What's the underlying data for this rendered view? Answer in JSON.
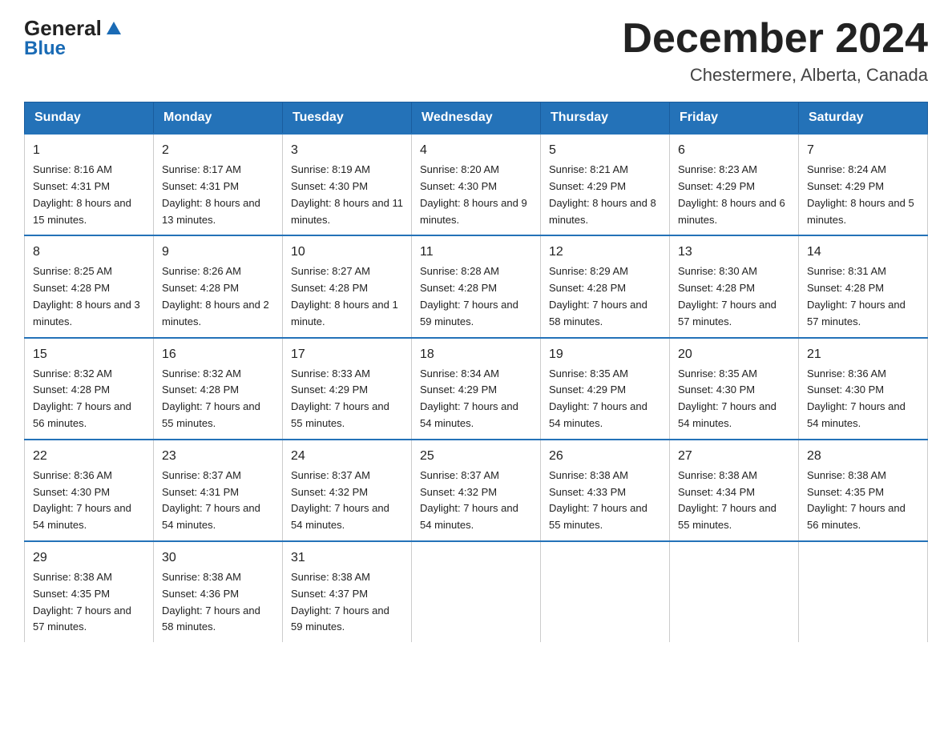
{
  "header": {
    "logo_general": "General",
    "logo_blue": "Blue",
    "month_title": "December 2024",
    "location": "Chestermere, Alberta, Canada"
  },
  "days_of_week": [
    "Sunday",
    "Monday",
    "Tuesday",
    "Wednesday",
    "Thursday",
    "Friday",
    "Saturday"
  ],
  "weeks": [
    [
      {
        "day": "1",
        "sunrise": "8:16 AM",
        "sunset": "4:31 PM",
        "daylight": "8 hours and 15 minutes."
      },
      {
        "day": "2",
        "sunrise": "8:17 AM",
        "sunset": "4:31 PM",
        "daylight": "8 hours and 13 minutes."
      },
      {
        "day": "3",
        "sunrise": "8:19 AM",
        "sunset": "4:30 PM",
        "daylight": "8 hours and 11 minutes."
      },
      {
        "day": "4",
        "sunrise": "8:20 AM",
        "sunset": "4:30 PM",
        "daylight": "8 hours and 9 minutes."
      },
      {
        "day": "5",
        "sunrise": "8:21 AM",
        "sunset": "4:29 PM",
        "daylight": "8 hours and 8 minutes."
      },
      {
        "day": "6",
        "sunrise": "8:23 AM",
        "sunset": "4:29 PM",
        "daylight": "8 hours and 6 minutes."
      },
      {
        "day": "7",
        "sunrise": "8:24 AM",
        "sunset": "4:29 PM",
        "daylight": "8 hours and 5 minutes."
      }
    ],
    [
      {
        "day": "8",
        "sunrise": "8:25 AM",
        "sunset": "4:28 PM",
        "daylight": "8 hours and 3 minutes."
      },
      {
        "day": "9",
        "sunrise": "8:26 AM",
        "sunset": "4:28 PM",
        "daylight": "8 hours and 2 minutes."
      },
      {
        "day": "10",
        "sunrise": "8:27 AM",
        "sunset": "4:28 PM",
        "daylight": "8 hours and 1 minute."
      },
      {
        "day": "11",
        "sunrise": "8:28 AM",
        "sunset": "4:28 PM",
        "daylight": "7 hours and 59 minutes."
      },
      {
        "day": "12",
        "sunrise": "8:29 AM",
        "sunset": "4:28 PM",
        "daylight": "7 hours and 58 minutes."
      },
      {
        "day": "13",
        "sunrise": "8:30 AM",
        "sunset": "4:28 PM",
        "daylight": "7 hours and 57 minutes."
      },
      {
        "day": "14",
        "sunrise": "8:31 AM",
        "sunset": "4:28 PM",
        "daylight": "7 hours and 57 minutes."
      }
    ],
    [
      {
        "day": "15",
        "sunrise": "8:32 AM",
        "sunset": "4:28 PM",
        "daylight": "7 hours and 56 minutes."
      },
      {
        "day": "16",
        "sunrise": "8:32 AM",
        "sunset": "4:28 PM",
        "daylight": "7 hours and 55 minutes."
      },
      {
        "day": "17",
        "sunrise": "8:33 AM",
        "sunset": "4:29 PM",
        "daylight": "7 hours and 55 minutes."
      },
      {
        "day": "18",
        "sunrise": "8:34 AM",
        "sunset": "4:29 PM",
        "daylight": "7 hours and 54 minutes."
      },
      {
        "day": "19",
        "sunrise": "8:35 AM",
        "sunset": "4:29 PM",
        "daylight": "7 hours and 54 minutes."
      },
      {
        "day": "20",
        "sunrise": "8:35 AM",
        "sunset": "4:30 PM",
        "daylight": "7 hours and 54 minutes."
      },
      {
        "day": "21",
        "sunrise": "8:36 AM",
        "sunset": "4:30 PM",
        "daylight": "7 hours and 54 minutes."
      }
    ],
    [
      {
        "day": "22",
        "sunrise": "8:36 AM",
        "sunset": "4:30 PM",
        "daylight": "7 hours and 54 minutes."
      },
      {
        "day": "23",
        "sunrise": "8:37 AM",
        "sunset": "4:31 PM",
        "daylight": "7 hours and 54 minutes."
      },
      {
        "day": "24",
        "sunrise": "8:37 AM",
        "sunset": "4:32 PM",
        "daylight": "7 hours and 54 minutes."
      },
      {
        "day": "25",
        "sunrise": "8:37 AM",
        "sunset": "4:32 PM",
        "daylight": "7 hours and 54 minutes."
      },
      {
        "day": "26",
        "sunrise": "8:38 AM",
        "sunset": "4:33 PM",
        "daylight": "7 hours and 55 minutes."
      },
      {
        "day": "27",
        "sunrise": "8:38 AM",
        "sunset": "4:34 PM",
        "daylight": "7 hours and 55 minutes."
      },
      {
        "day": "28",
        "sunrise": "8:38 AM",
        "sunset": "4:35 PM",
        "daylight": "7 hours and 56 minutes."
      }
    ],
    [
      {
        "day": "29",
        "sunrise": "8:38 AM",
        "sunset": "4:35 PM",
        "daylight": "7 hours and 57 minutes."
      },
      {
        "day": "30",
        "sunrise": "8:38 AM",
        "sunset": "4:36 PM",
        "daylight": "7 hours and 58 minutes."
      },
      {
        "day": "31",
        "sunrise": "8:38 AM",
        "sunset": "4:37 PM",
        "daylight": "7 hours and 59 minutes."
      },
      null,
      null,
      null,
      null
    ]
  ],
  "labels": {
    "sunrise": "Sunrise:",
    "sunset": "Sunset:",
    "daylight": "Daylight:"
  }
}
